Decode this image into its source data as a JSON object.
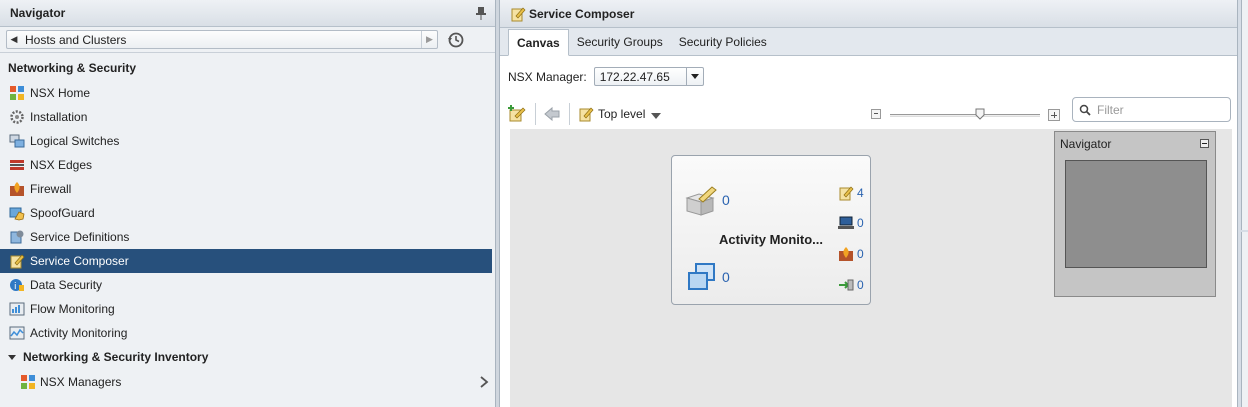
{
  "navigator": {
    "title": "Navigator",
    "breadcrumb": "Hosts and Clusters",
    "section_title": "Networking & Security",
    "items": [
      {
        "label": "NSX Home",
        "icon": "nsx-home-icon"
      },
      {
        "label": "Installation",
        "icon": "gears-icon"
      },
      {
        "label": "Logical Switches",
        "icon": "logical-switch-icon"
      },
      {
        "label": "NSX Edges",
        "icon": "nsx-edge-icon"
      },
      {
        "label": "Firewall",
        "icon": "firewall-icon"
      },
      {
        "label": "SpoofGuard",
        "icon": "spoofguard-icon"
      },
      {
        "label": "Service Definitions",
        "icon": "service-definitions-icon"
      },
      {
        "label": "Service Composer",
        "icon": "service-composer-icon",
        "selected": true
      },
      {
        "label": "Data Security",
        "icon": "data-security-icon"
      },
      {
        "label": "Flow Monitoring",
        "icon": "flow-monitoring-icon"
      },
      {
        "label": "Activity Monitoring",
        "icon": "activity-monitoring-icon"
      }
    ],
    "inventory_group": "Networking & Security Inventory",
    "inventory_items": [
      {
        "label": "NSX Managers",
        "icon": "nsx-managers-icon"
      }
    ]
  },
  "main": {
    "title": "Service Composer",
    "tabs": [
      {
        "label": "Canvas",
        "active": true
      },
      {
        "label": "Security Groups",
        "active": false
      },
      {
        "label": "Security Policies",
        "active": false
      }
    ],
    "manager_label": "NSX Manager:",
    "manager_value": "172.22.47.65",
    "toolbar": {
      "top_level_label": "Top level",
      "filter_placeholder": "Filter",
      "zoom_level": 0.6
    },
    "canvas": {
      "card": {
        "title": "Activity Monito...",
        "policies_count": "0",
        "groups_count": "0",
        "guest_introspection_count": "4",
        "endpoint_count": "0",
        "firewall_count": "0",
        "network_introspection_count": "0"
      },
      "minimap_title": "Navigator"
    }
  },
  "colors": {
    "selected_bg": "#27507c",
    "link_blue": "#2a63b0",
    "canvas_bg": "#e6e6e6"
  }
}
